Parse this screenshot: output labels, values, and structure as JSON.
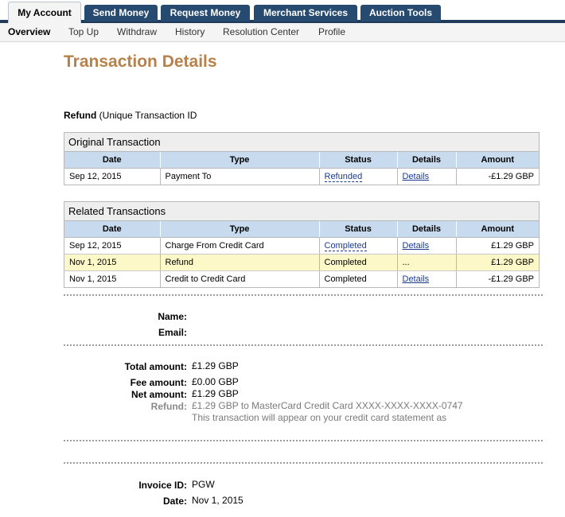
{
  "tabs": [
    {
      "label": "My Account",
      "active": true
    },
    {
      "label": "Send Money"
    },
    {
      "label": "Request Money"
    },
    {
      "label": "Merchant Services"
    },
    {
      "label": "Auction Tools"
    }
  ],
  "subnav": [
    {
      "label": "Overview",
      "active": true
    },
    {
      "label": "Top Up"
    },
    {
      "label": "Withdraw"
    },
    {
      "label": "History"
    },
    {
      "label": "Resolution Center"
    },
    {
      "label": "Profile"
    }
  ],
  "title": "Transaction Details",
  "refund_heading": {
    "type": "Refund",
    "rest": " (Unique Transaction ID"
  },
  "table_headers": [
    "Date",
    "Type",
    "Status",
    "Details",
    "Amount"
  ],
  "original_transaction": {
    "caption": "Original Transaction",
    "rows": [
      {
        "date": "Sep 12, 2015",
        "type": "Payment To",
        "status": "Refunded",
        "details": "Details",
        "amount": "-£1.29 GBP"
      }
    ]
  },
  "related_transactions": {
    "caption": "Related Transactions",
    "rows": [
      {
        "date": "Sep 12, 2015",
        "type": "Charge From Credit Card",
        "status": "Completed",
        "details": "Details",
        "amount": "£1.29 GBP"
      },
      {
        "date": "Nov 1, 2015",
        "type": "Refund",
        "status": "Completed",
        "details": "...",
        "amount": "£1.29 GBP"
      },
      {
        "date": "Nov 1, 2015",
        "type": "Credit to Credit Card",
        "status": "Completed",
        "details": "Details",
        "amount": "-£1.29 GBP"
      }
    ]
  },
  "contact": {
    "name_label": "Name:",
    "email_label": "Email:"
  },
  "amounts": {
    "total_label": "Total amount:",
    "total_value": "£1.29 GBP",
    "fee_label": "Fee amount:",
    "fee_value": "£0.00 GBP",
    "net_label": "Net amount:",
    "net_value": "£1.29 GBP",
    "refund_label": "Refund:",
    "refund_value": "£1.29 GBP to MasterCard Credit Card XXXX-XXXX-XXXX-0747",
    "refund_note": "This transaction will appear on your credit card statement as"
  },
  "invoice": {
    "invoice_label": "Invoice ID:",
    "invoice_value": "PGW",
    "date_label": "Date:",
    "date_value": "Nov 1, 2015"
  },
  "colors": {
    "tab_bg": "#264a70",
    "title": "#b8814a",
    "header_bg": "#c8dbee",
    "highlight_row": "#fdf8c8",
    "link": "#1c3b8f"
  }
}
